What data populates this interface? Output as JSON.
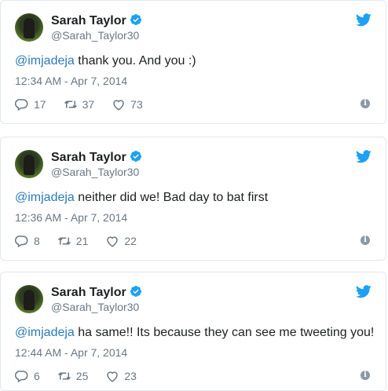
{
  "tweets": [
    {
      "name": "Sarah Taylor",
      "handle": "@Sarah_Taylor30",
      "mention": "@imjadeja",
      "text": " thank you. And you :)",
      "time": "12:34 AM - Apr 7, 2014",
      "replies": "17",
      "retweets": "37",
      "likes": "73"
    },
    {
      "name": "Sarah Taylor",
      "handle": "@Sarah_Taylor30",
      "mention": "@imjadeja",
      "text": " neither did we! Bad day to bat first",
      "time": "12:36 AM - Apr 7, 2014",
      "replies": "8",
      "retweets": "21",
      "likes": "22"
    },
    {
      "name": "Sarah Taylor",
      "handle": "@Sarah_Taylor30",
      "mention": "@imjadeja",
      "text": " ha same!! Its because they can see me tweeting you!",
      "time": "12:44 AM - Apr 7, 2014",
      "replies": "6",
      "retweets": "25",
      "likes": "23"
    }
  ],
  "colors": {
    "link": "#2b7bb9",
    "muted": "#697882",
    "verified": "#1da1f2",
    "twitter": "#1da1f2"
  },
  "icons": [
    "verified-badge-icon",
    "twitter-bird-icon",
    "reply-icon",
    "retweet-icon",
    "like-icon",
    "info-icon"
  ]
}
